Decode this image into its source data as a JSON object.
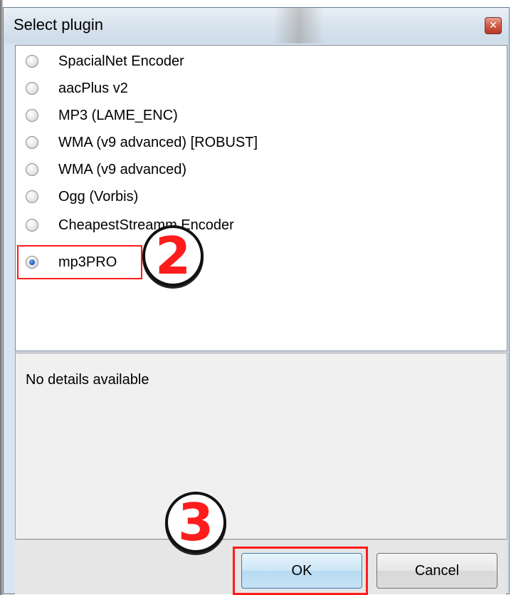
{
  "window": {
    "title": "Select plugin"
  },
  "plugins": [
    {
      "label": "SpacialNet Encoder",
      "checked": false
    },
    {
      "label": "aacPlus v2",
      "checked": false
    },
    {
      "label": "MP3 (LAME_ENC)",
      "checked": false
    },
    {
      "label": "WMA (v9 advanced) [ROBUST]",
      "checked": false
    },
    {
      "label": "WMA (v9 advanced)",
      "checked": false
    },
    {
      "label": "Ogg (Vorbis)",
      "checked": false
    },
    {
      "label": "CheapestStreamm Encoder",
      "checked": false
    },
    {
      "label": "mp3PRO",
      "checked": true
    }
  ],
  "details": {
    "text": "No details available"
  },
  "buttons": {
    "ok": "OK",
    "cancel": "Cancel"
  },
  "annotations": {
    "step2": "2",
    "step3": "3"
  },
  "colors": {
    "annotation_red": "#ff1a1a",
    "selected_radio": "#1c5fc2"
  }
}
